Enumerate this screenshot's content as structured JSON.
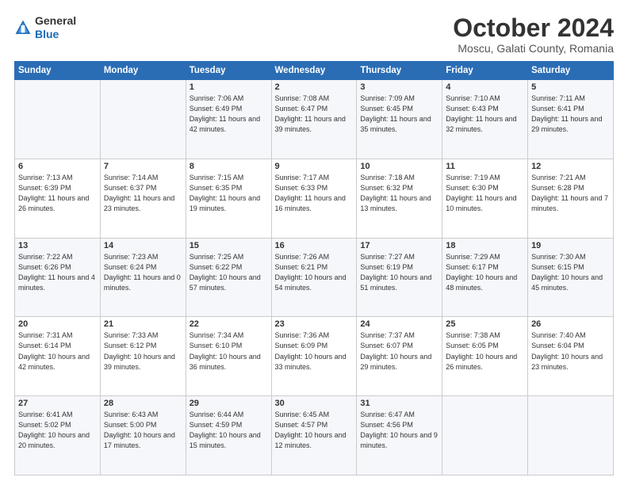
{
  "header": {
    "logo_general": "General",
    "logo_blue": "Blue",
    "month_title": "October 2024",
    "location": "Moscu, Galati County, Romania"
  },
  "weekdays": [
    "Sunday",
    "Monday",
    "Tuesday",
    "Wednesday",
    "Thursday",
    "Friday",
    "Saturday"
  ],
  "weeks": [
    [
      {
        "day": "",
        "info": ""
      },
      {
        "day": "",
        "info": ""
      },
      {
        "day": "1",
        "info": "Sunrise: 7:06 AM\nSunset: 6:49 PM\nDaylight: 11 hours and 42 minutes."
      },
      {
        "day": "2",
        "info": "Sunrise: 7:08 AM\nSunset: 6:47 PM\nDaylight: 11 hours and 39 minutes."
      },
      {
        "day": "3",
        "info": "Sunrise: 7:09 AM\nSunset: 6:45 PM\nDaylight: 11 hours and 35 minutes."
      },
      {
        "day": "4",
        "info": "Sunrise: 7:10 AM\nSunset: 6:43 PM\nDaylight: 11 hours and 32 minutes."
      },
      {
        "day": "5",
        "info": "Sunrise: 7:11 AM\nSunset: 6:41 PM\nDaylight: 11 hours and 29 minutes."
      }
    ],
    [
      {
        "day": "6",
        "info": "Sunrise: 7:13 AM\nSunset: 6:39 PM\nDaylight: 11 hours and 26 minutes."
      },
      {
        "day": "7",
        "info": "Sunrise: 7:14 AM\nSunset: 6:37 PM\nDaylight: 11 hours and 23 minutes."
      },
      {
        "day": "8",
        "info": "Sunrise: 7:15 AM\nSunset: 6:35 PM\nDaylight: 11 hours and 19 minutes."
      },
      {
        "day": "9",
        "info": "Sunrise: 7:17 AM\nSunset: 6:33 PM\nDaylight: 11 hours and 16 minutes."
      },
      {
        "day": "10",
        "info": "Sunrise: 7:18 AM\nSunset: 6:32 PM\nDaylight: 11 hours and 13 minutes."
      },
      {
        "day": "11",
        "info": "Sunrise: 7:19 AM\nSunset: 6:30 PM\nDaylight: 11 hours and 10 minutes."
      },
      {
        "day": "12",
        "info": "Sunrise: 7:21 AM\nSunset: 6:28 PM\nDaylight: 11 hours and 7 minutes."
      }
    ],
    [
      {
        "day": "13",
        "info": "Sunrise: 7:22 AM\nSunset: 6:26 PM\nDaylight: 11 hours and 4 minutes."
      },
      {
        "day": "14",
        "info": "Sunrise: 7:23 AM\nSunset: 6:24 PM\nDaylight: 11 hours and 0 minutes."
      },
      {
        "day": "15",
        "info": "Sunrise: 7:25 AM\nSunset: 6:22 PM\nDaylight: 10 hours and 57 minutes."
      },
      {
        "day": "16",
        "info": "Sunrise: 7:26 AM\nSunset: 6:21 PM\nDaylight: 10 hours and 54 minutes."
      },
      {
        "day": "17",
        "info": "Sunrise: 7:27 AM\nSunset: 6:19 PM\nDaylight: 10 hours and 51 minutes."
      },
      {
        "day": "18",
        "info": "Sunrise: 7:29 AM\nSunset: 6:17 PM\nDaylight: 10 hours and 48 minutes."
      },
      {
        "day": "19",
        "info": "Sunrise: 7:30 AM\nSunset: 6:15 PM\nDaylight: 10 hours and 45 minutes."
      }
    ],
    [
      {
        "day": "20",
        "info": "Sunrise: 7:31 AM\nSunset: 6:14 PM\nDaylight: 10 hours and 42 minutes."
      },
      {
        "day": "21",
        "info": "Sunrise: 7:33 AM\nSunset: 6:12 PM\nDaylight: 10 hours and 39 minutes."
      },
      {
        "day": "22",
        "info": "Sunrise: 7:34 AM\nSunset: 6:10 PM\nDaylight: 10 hours and 36 minutes."
      },
      {
        "day": "23",
        "info": "Sunrise: 7:36 AM\nSunset: 6:09 PM\nDaylight: 10 hours and 33 minutes."
      },
      {
        "day": "24",
        "info": "Sunrise: 7:37 AM\nSunset: 6:07 PM\nDaylight: 10 hours and 29 minutes."
      },
      {
        "day": "25",
        "info": "Sunrise: 7:38 AM\nSunset: 6:05 PM\nDaylight: 10 hours and 26 minutes."
      },
      {
        "day": "26",
        "info": "Sunrise: 7:40 AM\nSunset: 6:04 PM\nDaylight: 10 hours and 23 minutes."
      }
    ],
    [
      {
        "day": "27",
        "info": "Sunrise: 6:41 AM\nSunset: 5:02 PM\nDaylight: 10 hours and 20 minutes."
      },
      {
        "day": "28",
        "info": "Sunrise: 6:43 AM\nSunset: 5:00 PM\nDaylight: 10 hours and 17 minutes."
      },
      {
        "day": "29",
        "info": "Sunrise: 6:44 AM\nSunset: 4:59 PM\nDaylight: 10 hours and 15 minutes."
      },
      {
        "day": "30",
        "info": "Sunrise: 6:45 AM\nSunset: 4:57 PM\nDaylight: 10 hours and 12 minutes."
      },
      {
        "day": "31",
        "info": "Sunrise: 6:47 AM\nSunset: 4:56 PM\nDaylight: 10 hours and 9 minutes."
      },
      {
        "day": "",
        "info": ""
      },
      {
        "day": "",
        "info": ""
      }
    ]
  ]
}
